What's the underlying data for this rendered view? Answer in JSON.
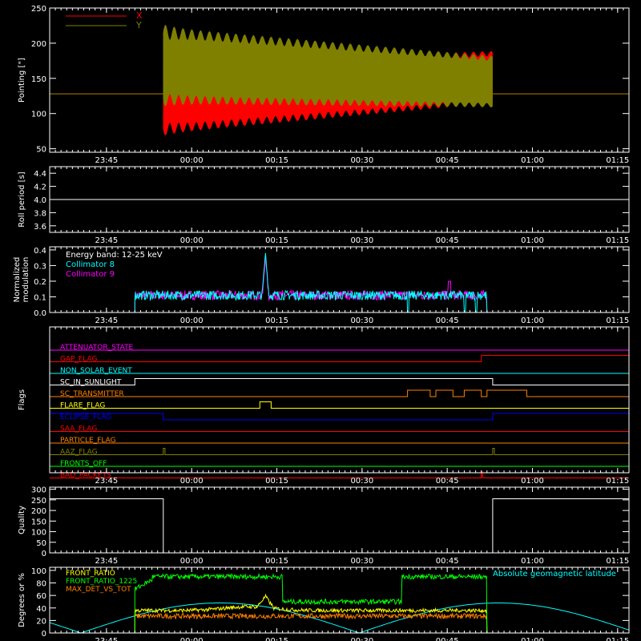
{
  "colors": {
    "background": "#000000",
    "axes": "#ffffff",
    "x_pointing": "#ff0000",
    "y_pointing": "#808000",
    "collimator8": "#00ffff",
    "collimator9": "#ff00ff",
    "front_ratio": "#ffff00",
    "front_ratio_1225": "#00ff00",
    "max_det_vs_tot": "#ff8000",
    "geomag": "#00ffff"
  },
  "time_axis": {
    "start": "23:35",
    "end": "01:17",
    "ticks": [
      "23:45",
      "00:00",
      "00:15",
      "00:30",
      "00:45",
      "01:00",
      "01:15"
    ]
  },
  "chart_data": [
    {
      "type": "line",
      "panel": "pointing",
      "ylabel": "Pointing [\"]",
      "ylim": [
        45,
        250
      ],
      "yticks": [
        "50",
        "100",
        "150",
        "200",
        "250"
      ],
      "legend": [
        "X",
        "Y"
      ],
      "series": [
        {
          "name": "X",
          "color": "#ff0000",
          "baseline": 128,
          "active": [
            "23:55",
            "00:53"
          ],
          "min_start": 78,
          "min_end": 118,
          "max_start": 165,
          "max_end": 185
        },
        {
          "name": "Y",
          "color": "#808000",
          "baseline": 128,
          "active": [
            "23:55",
            "00:53"
          ],
          "min_start": 120,
          "min_end": 112,
          "max_start": 215,
          "max_end": 178
        }
      ]
    },
    {
      "type": "line",
      "panel": "roll",
      "ylabel": "Roll period [s]",
      "ylim": [
        3.5,
        4.5
      ],
      "yticks": [
        "3.6",
        "3.8",
        "4.0",
        "4.2",
        "4.4"
      ],
      "series": [
        {
          "name": "",
          "color": "#ffffff",
          "value": 4.0
        }
      ]
    },
    {
      "type": "line",
      "panel": "modulation",
      "ylabel": [
        "Normalized",
        "modulation"
      ],
      "ylim": [
        0,
        0.42
      ],
      "yticks": [
        "0.0",
        "0.1",
        "0.2",
        "0.3",
        "0.4"
      ],
      "legend": [
        "Energy band: 12-25 keV",
        "Collimator 8",
        "Collimator 9"
      ],
      "active": [
        "23:50",
        "00:52"
      ],
      "base_level": 0.11,
      "spike": {
        "time": "00:13",
        "value": 0.38
      },
      "series": [
        {
          "name": "Collimator 8",
          "color": "#00ffff"
        },
        {
          "name": "Collimator 9",
          "color": "#ff00ff"
        }
      ]
    },
    {
      "type": "line",
      "panel": "flags",
      "ylabel": "Flags",
      "series": [
        {
          "name": "ATTENUATOR_STATE",
          "color": "#ff00ff",
          "segments": [
            [
              "23:35",
              "01:17",
              0
            ]
          ]
        },
        {
          "name": "GAP_FLAG",
          "color": "#ff0000",
          "segments": [
            [
              "23:35",
              "00:51",
              0
            ],
            [
              "00:51",
              "01:17",
              1
            ]
          ]
        },
        {
          "name": "NON_SOLAR_EVENT",
          "color": "#00ffff",
          "segments": [
            [
              "23:35",
              "01:17",
              0
            ]
          ]
        },
        {
          "name": "SC_IN_SUNLIGHT",
          "color": "#ffffff",
          "segments": [
            [
              "23:35",
              "23:50",
              0
            ],
            [
              "23:50",
              "00:53",
              1
            ],
            [
              "00:53",
              "01:17",
              0
            ]
          ]
        },
        {
          "name": "SC_TRANSMITTER",
          "color": "#ff8000",
          "segments": [
            [
              "23:35",
              "00:38",
              0
            ],
            [
              "00:38",
              "00:42",
              1
            ],
            [
              "00:42",
              "00:43",
              0
            ],
            [
              "00:43",
              "00:46",
              1
            ],
            [
              "00:46",
              "00:48",
              0
            ],
            [
              "00:48",
              "00:51",
              1
            ],
            [
              "00:51",
              "00:52",
              0
            ],
            [
              "00:52",
              "00:59",
              1
            ],
            [
              "00:59",
              "01:17",
              0
            ]
          ]
        },
        {
          "name": "FLARE_FLAG",
          "color": "#ffff00",
          "segments": [
            [
              "23:35",
              "00:12",
              0
            ],
            [
              "00:12",
              "00:14",
              1
            ],
            [
              "00:14",
              "01:17",
              0
            ]
          ]
        },
        {
          "name": "ECLIPSE_FLAG",
          "color": "#0000ff",
          "segments": [
            [
              "23:35",
              "23:55",
              1
            ],
            [
              "23:55",
              "00:53",
              0
            ],
            [
              "00:53",
              "01:17",
              1
            ]
          ]
        },
        {
          "name": "SAA_FLAG",
          "color": "#ff0000",
          "segments": [
            [
              "23:35",
              "01:17",
              0
            ]
          ]
        },
        {
          "name": "PARTICLE_FLAG",
          "color": "#ff8000",
          "segments": [
            [
              "23:35",
              "01:17",
              0
            ]
          ]
        },
        {
          "name": "AAZ_FLAG",
          "color": "#808000",
          "segments": [
            [
              "23:35",
              "23:55",
              0
            ],
            [
              "23:55",
              "23:55.3",
              1
            ],
            [
              "23:55.3",
              "00:53",
              0
            ],
            [
              "00:53",
              "00:53.3",
              1
            ],
            [
              "00:53.3",
              "01:17",
              0
            ]
          ]
        },
        {
          "name": "FRONTS_OFF",
          "color": "#00ff00",
          "segments": [
            [
              "23:35",
              "01:17",
              0
            ]
          ]
        },
        {
          "name": "BAD_PACKETS",
          "color": "#ff0000",
          "segments": [
            [
              "23:35",
              "00:51",
              0
            ],
            [
              "00:51",
              "00:51.2",
              1
            ],
            [
              "00:51.2",
              "01:17",
              0
            ]
          ]
        }
      ]
    },
    {
      "type": "line",
      "panel": "quality",
      "ylabel": "Quality",
      "ylim": [
        0,
        310
      ],
      "yticks": [
        "0",
        "50",
        "100",
        "150",
        "200",
        "250",
        "300"
      ],
      "series": [
        {
          "name": "",
          "color": "#ffffff",
          "points": [
            [
              "23:35",
              255
            ],
            [
              "23:55",
              255
            ],
            [
              "23:55",
              0
            ],
            [
              "00:53",
              0
            ],
            [
              "00:53",
              255
            ],
            [
              "01:17",
              255
            ]
          ]
        }
      ]
    },
    {
      "type": "line",
      "panel": "ratios",
      "ylabel": "Degrees or %",
      "ylim": [
        0,
        105
      ],
      "yticks": [
        "0",
        "20",
        "40",
        "60",
        "80",
        "100"
      ],
      "legend": [
        "FRONT_RATIO",
        "FRONT_RATIO_1225",
        "MAX_DET_VS_TOT"
      ],
      "annotation": "Absolute geomagnetic latitude",
      "series": [
        {
          "name": "FRONT_RATIO",
          "color": "#ffff00"
        },
        {
          "name": "FRONT_RATIO_1225",
          "color": "#00ff00"
        },
        {
          "name": "MAX_DET_VS_TOT",
          "color": "#ff8000"
        },
        {
          "name": "Absolute geomagnetic latitude",
          "color": "#00ffff"
        }
      ]
    }
  ]
}
